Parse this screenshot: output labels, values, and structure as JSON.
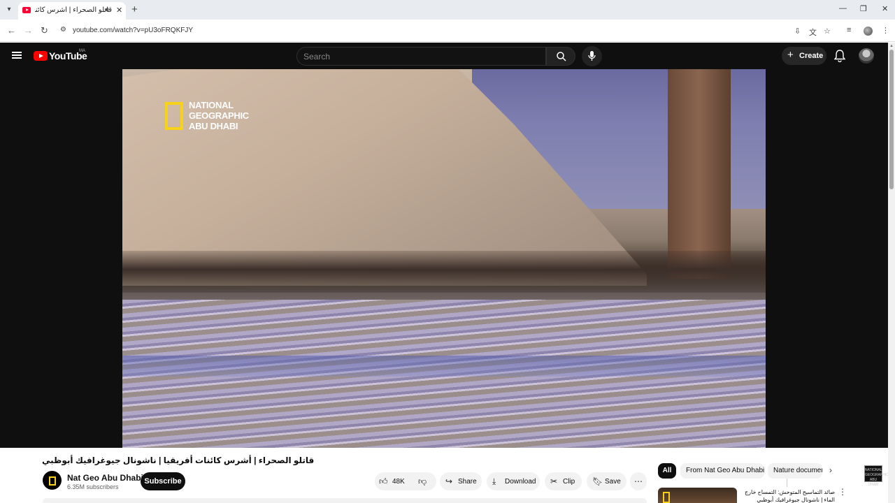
{
  "browser": {
    "tab_title": "قاتلو الصحراء | أشرس كائنات أفريقيا | ناشونال جيوغرافيك أبوظبي",
    "url": "youtube.com/watch?v=pU3oFRQKFJY",
    "tab_menu_icon": "chevron-down-icon",
    "new_tab_icon": "plus-icon"
  },
  "header": {
    "logo_text": "YouTube",
    "country_code": "MA",
    "search_placeholder": "Search",
    "create_label": "Create"
  },
  "video": {
    "title": "قاتلو الصحراء | أشرس كائنات أفريقيا | ناشونال جيوغرافيك أبوظبي",
    "watermark_text": "NATIONAL GEOGRAPHIC ABU DHABI",
    "overlay_lines": [
      "NATIONAL",
      "GEOGRAPHIC",
      "ABU DHABI"
    ]
  },
  "channel": {
    "name": "Nat Geo Abu Dhabi",
    "subscribers": "6.35M subscribers",
    "subscribe_label": "Subscribe"
  },
  "actions": {
    "likes": "48K",
    "share_label": "Share",
    "download_label": "Download",
    "clip_label": "Clip",
    "save_label": "Save"
  },
  "chips": [
    "All",
    "From Nat Geo Abu Dhabi",
    "Nature documen"
  ],
  "recommended": [
    {
      "title": "صائد التماسيح المتوحش: التمساح خارج الماء | ناشونال جيوغرافيك أبوظبي"
    }
  ],
  "colors": {
    "brand_red": "#ff0000",
    "natgeo_yellow": "#f6d219",
    "header_bg": "#0f0f0f"
  }
}
